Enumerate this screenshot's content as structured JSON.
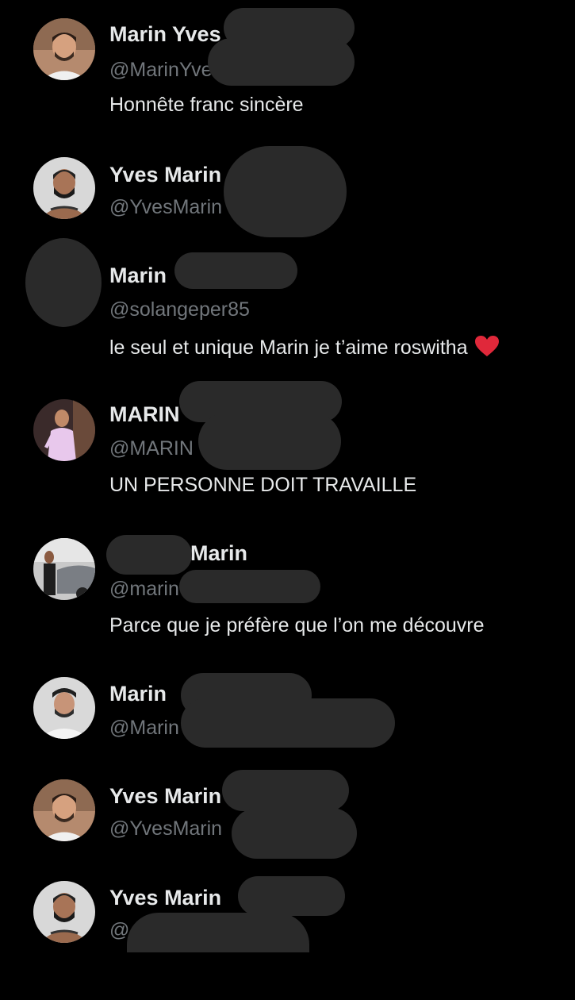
{
  "accounts": [
    {
      "name": "Marin Yves",
      "handle": "@MarinYve",
      "bio": "Honnête franc sincère",
      "avatar_icon": "profile-photo-man-white-shirt"
    },
    {
      "name": "Yves Marin",
      "handle": "@YvesMarin",
      "bio": "",
      "avatar_icon": "profile-photo-man-tattoo"
    },
    {
      "name": "Marin",
      "handle": "@solangeper85",
      "bio": "le seul et unique Marin je t’aime roswitha",
      "bio_icon": "red-heart-icon",
      "avatar_icon": "redacted-avatar"
    },
    {
      "name": "MARIN",
      "handle": "@MARIN",
      "bio": "UN PERSONNE DOIT TRAVAILLE",
      "avatar_icon": "profile-photo-man-pink-shirt"
    },
    {
      "name": "Marin",
      "handle": "@marin",
      "bio": "Parce que je préfère que l’on me découvre",
      "avatar_icon": "profile-photo-man-by-car"
    },
    {
      "name": "Marin",
      "handle": "@Marin",
      "bio": "",
      "avatar_icon": "profile-photo-man-cap"
    },
    {
      "name": "Yves Marin",
      "handle": "@YvesMarin",
      "bio": "",
      "avatar_icon": "profile-photo-man-white-shirt"
    },
    {
      "name": "Yves Marin",
      "handle": "@",
      "bio": "",
      "avatar_icon": "profile-photo-man-tattoo"
    }
  ],
  "colors": {
    "background": "#000000",
    "primary_text": "#e7e9ea",
    "secondary_text": "#71767b",
    "redaction": "#2a2a2a",
    "heart": "#e0283a"
  }
}
